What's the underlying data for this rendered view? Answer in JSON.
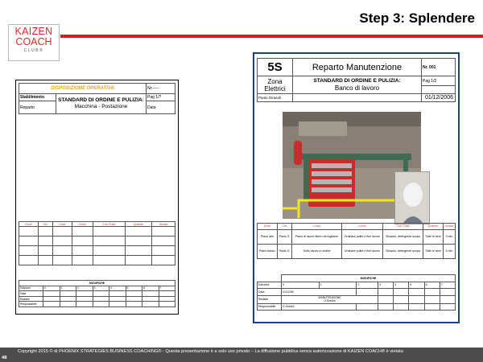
{
  "slide_title": "Step 3: Splendere",
  "logo": {
    "line1": "KAIZEN",
    "line2": "COACH",
    "line3": "CLUB®"
  },
  "form_left": {
    "disposition": "DISPOSIZIONE OPERATIVA",
    "nr": "Nr.-----",
    "stabilimento": "Stabilimento",
    "standard": "STANDARD DI ORDINE E PULIZIA:",
    "pag": "Pag 1/?",
    "reparto": "Reparto",
    "data": "Data",
    "macchina": "Macchina - Postazione",
    "columns": [
      "Dove",
      "Chi",
      "Cosa",
      "Come",
      "Con Cosa",
      "Quando",
      "Durata"
    ],
    "modifiche": "MODIFICHE",
    "mod_rows": [
      "Edizione",
      "Data",
      "Redatto",
      "Responsabile"
    ],
    "mod_edizioni": [
      "0",
      "1",
      "2",
      "3",
      "4",
      "5",
      "6",
      "7"
    ]
  },
  "form_right": {
    "s5": "5S",
    "reparto": "Reparto Manutenzione",
    "nr": "Nr. 001",
    "zona": "Zona Elettrici",
    "standard": "STANDARD DI ORDINE E PULIZIA:",
    "pag": "Pag 1/2",
    "banco": "Banco di lavoro",
    "person": "Paolo Girasoli",
    "date": "01/12/2006",
    "columns": [
      "Dove",
      "Chi",
      "Cosa",
      "Come",
      "Con Cosa",
      "Quando",
      "Durata"
    ],
    "rows": [
      [
        "Piano alto",
        "Paolo G.",
        "Piano di lavoro libero da fogliame",
        "Ordinare pulite e fine lavoro",
        "Straccio, detergente scopa",
        "Tutte le sere",
        "3 min"
      ],
      [
        "Piano basso",
        "Paolo G.",
        "Sotto lavoro in ordine",
        "Ordinare pulite e fine lavoro",
        "Straccio, detergente scopa",
        "Tutte le sere",
        "3 min"
      ]
    ],
    "modifiche": "MODIFICHE",
    "mod_labels": [
      "Edizione",
      "Data",
      "Redatto",
      "Responsabile"
    ],
    "mod_edizioni": [
      "0",
      "1",
      "2",
      "3",
      "4",
      "5",
      "6",
      "7"
    ],
    "mod_date": "01/12/06",
    "mod_redatto": "MANUTENZIONE",
    "mod_redatto2": "G.Sorsini",
    "mod_resp": "G.Sorsini"
  },
  "footer": {
    "page": "48",
    "copyright": "Copyright 2015 © di PHOENIX STRATEGIES BUSINESS COACHING® - Questa presentazione è a solo uso privato – La diffusione pubblica senza autorizzazione di KAIZEN COACH® è vietata"
  },
  "colors": {
    "accent_red": "#cc2222",
    "form_border_blue": "#1d3f8a",
    "disposition_orange": "#f2a51a",
    "footer_gray": "#4d4d4d"
  }
}
